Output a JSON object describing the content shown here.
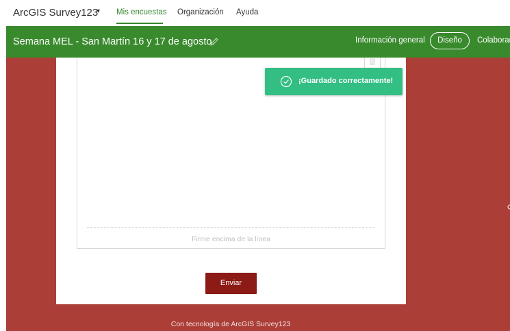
{
  "nav": {
    "app_title": "ArcGIS Survey123",
    "links": [
      "Mis encuestas",
      "Organización",
      "Ayuda"
    ]
  },
  "survey_bar": {
    "title": "Semana MEL - San Martín 16 y 17 de agosto.",
    "overview": "Información general",
    "design": "Diseño",
    "collaborate": "Colaborar"
  },
  "form": {
    "signature_hint": "Firme encima de la línea",
    "submit_label": "Enviar",
    "footer": "Con tecnología de ArcGIS Survey123"
  },
  "toast": {
    "message": "¡Guardado correctamente!"
  },
  "colors": {
    "brand_green": "#398a2d",
    "background_red": "#ab3f38",
    "submit_red": "#8c1a15",
    "toast_green": "#33bf84"
  }
}
